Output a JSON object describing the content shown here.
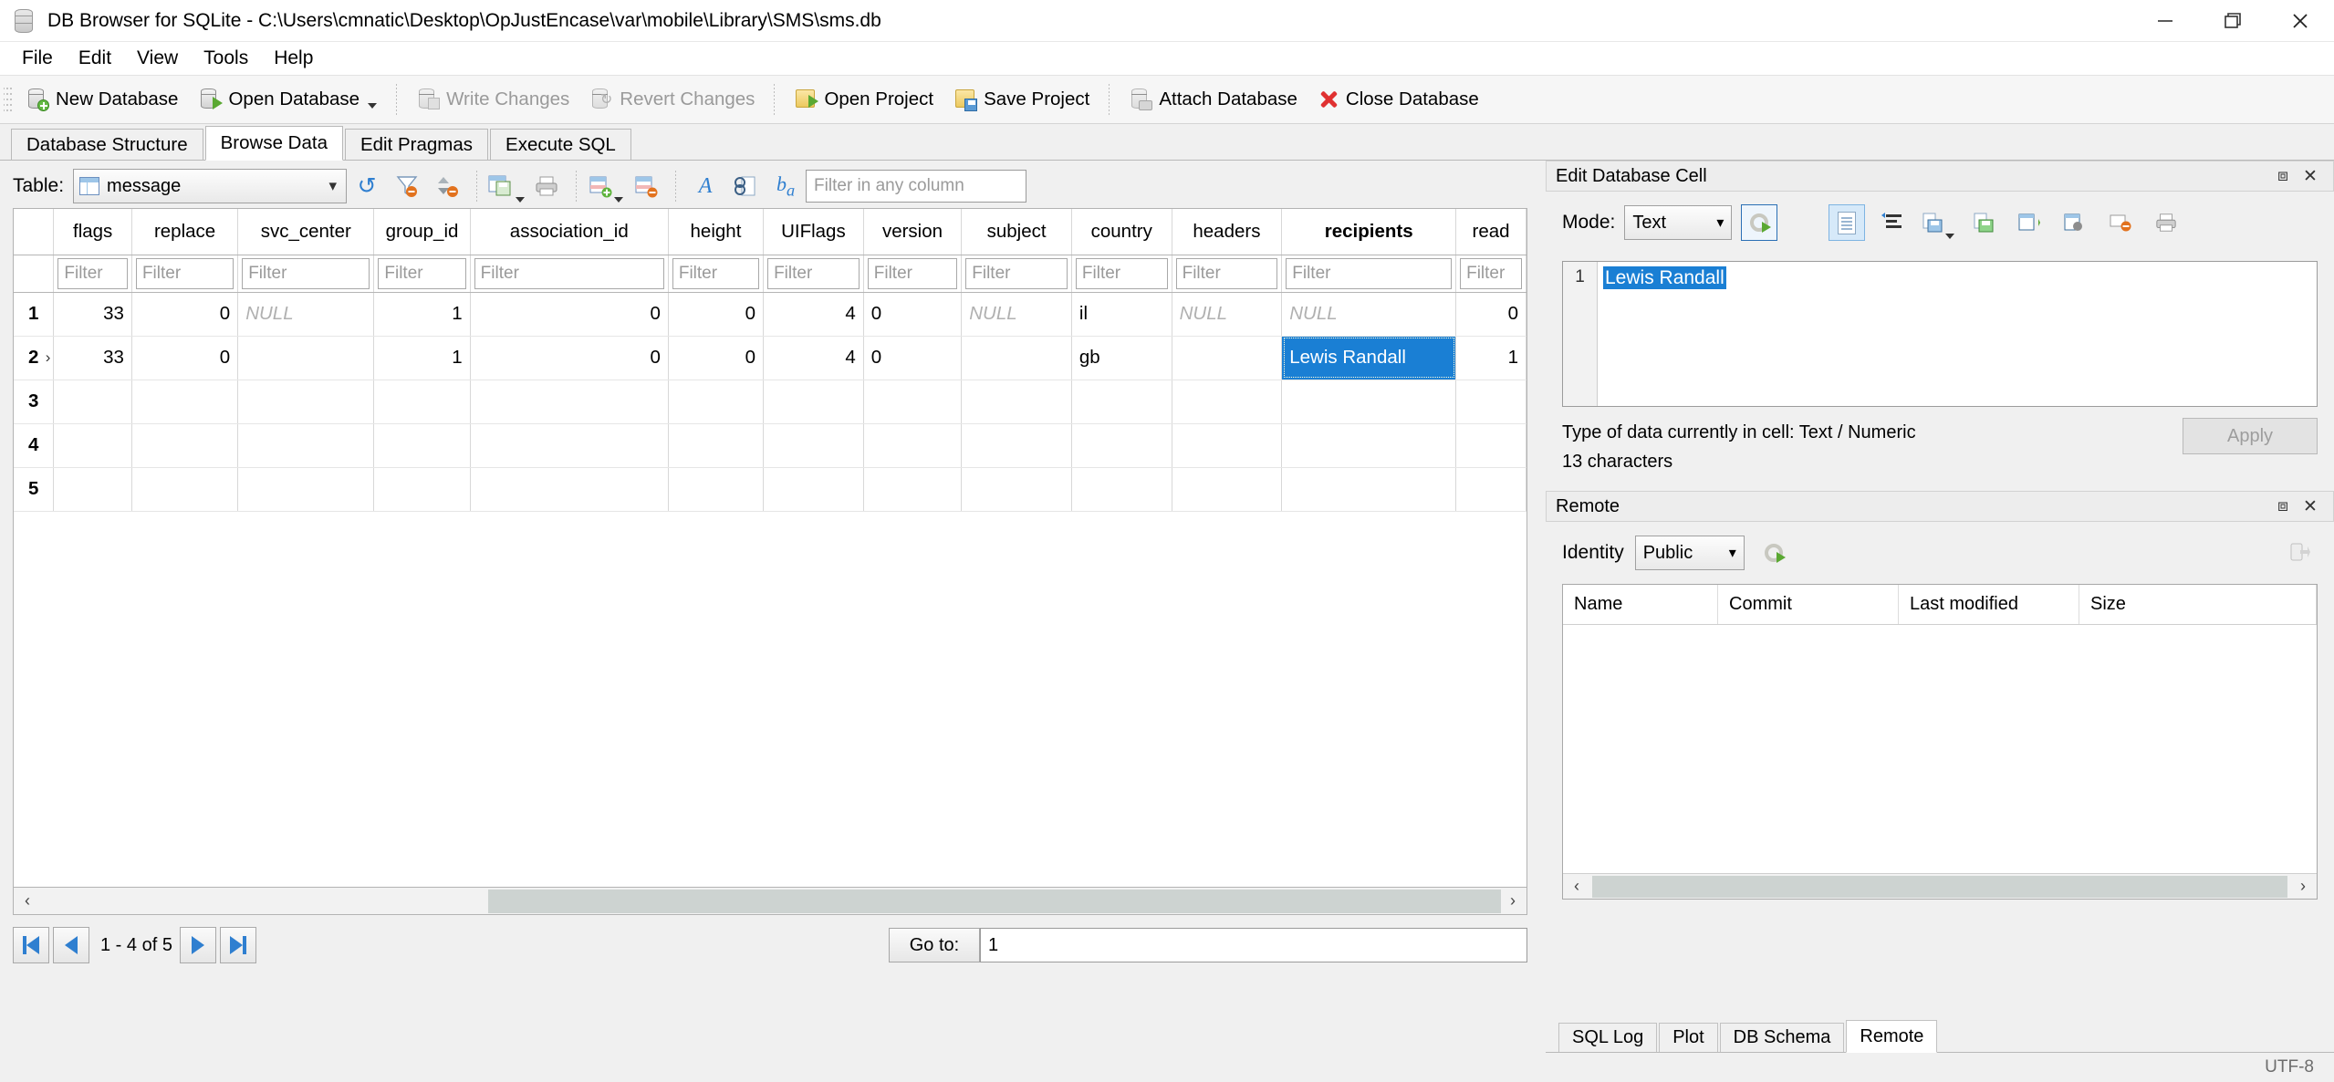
{
  "window": {
    "title": "DB Browser for SQLite - C:\\Users\\cmnatic\\Desktop\\OpJustEncase\\var\\mobile\\Library\\SMS\\sms.db",
    "minimize": "—",
    "maximize": "❐",
    "close": "✕"
  },
  "menubar": {
    "items": [
      "File",
      "Edit",
      "View",
      "Tools",
      "Help"
    ]
  },
  "toolbar": {
    "buttons": [
      {
        "label": "New Database",
        "icon": "database-new-icon",
        "enabled": true
      },
      {
        "label": "Open Database",
        "icon": "database-open-icon",
        "enabled": true
      },
      {
        "label": "Write Changes",
        "icon": "write-changes-icon",
        "enabled": false
      },
      {
        "label": "Revert Changes",
        "icon": "revert-changes-icon",
        "enabled": false
      },
      {
        "label": "Open Project",
        "icon": "project-open-icon",
        "enabled": true
      },
      {
        "label": "Save Project",
        "icon": "project-save-icon",
        "enabled": true
      },
      {
        "label": "Attach Database",
        "icon": "database-attach-icon",
        "enabled": true
      },
      {
        "label": "Close Database",
        "icon": "close-database-icon",
        "enabled": true
      }
    ]
  },
  "tabs": {
    "items": [
      "Database Structure",
      "Browse Data",
      "Edit Pragmas",
      "Execute SQL"
    ],
    "active": "Browse Data"
  },
  "browse": {
    "table_label": "Table:",
    "table_value": "message",
    "filter_placeholder": "Filter in any column",
    "toolbar_icons": [
      "refresh-icon",
      "clear-filter-icon",
      "clear-sort-icon",
      "save-results-icon",
      "print-icon",
      "insert-record-icon",
      "delete-record-icon",
      "font-size-icon",
      "find-icon",
      "conditional-format-icon"
    ]
  },
  "grid": {
    "columns": [
      "flags",
      "replace",
      "svc_center",
      "group_id",
      "association_id",
      "height",
      "UIFlags",
      "version",
      "subject",
      "country",
      "headers",
      "recipients",
      "read"
    ],
    "bold_column": "recipients",
    "filter_placeholder": "Filter",
    "rows": [
      {
        "n": "1",
        "marked": false,
        "cells": [
          {
            "v": "33",
            "align": "num"
          },
          {
            "v": "0",
            "align": "num"
          },
          {
            "v": "NULL",
            "align": "txt",
            "null": true
          },
          {
            "v": "1",
            "align": "num"
          },
          {
            "v": "0",
            "align": "num"
          },
          {
            "v": "0",
            "align": "num"
          },
          {
            "v": "4",
            "align": "num"
          },
          {
            "v": "0",
            "align": "txt"
          },
          {
            "v": "NULL",
            "align": "txt",
            "null": true
          },
          {
            "v": "il",
            "align": "txt"
          },
          {
            "v": "NULL",
            "align": "txt",
            "null": true
          },
          {
            "v": "NULL",
            "align": "txt",
            "null": true
          },
          {
            "v": "0",
            "align": "num"
          }
        ]
      },
      {
        "n": "2",
        "marked": true,
        "cells": [
          {
            "v": "33",
            "align": "num"
          },
          {
            "v": "0",
            "align": "num"
          },
          {
            "v": "",
            "align": "txt"
          },
          {
            "v": "1",
            "align": "num"
          },
          {
            "v": "0",
            "align": "num"
          },
          {
            "v": "0",
            "align": "num"
          },
          {
            "v": "4",
            "align": "num"
          },
          {
            "v": "0",
            "align": "txt"
          },
          {
            "v": "",
            "align": "txt"
          },
          {
            "v": "gb",
            "align": "txt"
          },
          {
            "v": "",
            "align": "txt"
          },
          {
            "v": "Lewis Randall",
            "align": "txt",
            "selected": true
          },
          {
            "v": "1",
            "align": "num"
          }
        ]
      },
      {
        "n": "3",
        "marked": false,
        "cells": [
          {
            "v": ""
          },
          {
            "v": ""
          },
          {
            "v": ""
          },
          {
            "v": ""
          },
          {
            "v": ""
          },
          {
            "v": ""
          },
          {
            "v": ""
          },
          {
            "v": ""
          },
          {
            "v": ""
          },
          {
            "v": ""
          },
          {
            "v": ""
          },
          {
            "v": ""
          },
          {
            "v": ""
          }
        ]
      },
      {
        "n": "4",
        "marked": false,
        "cells": [
          {
            "v": ""
          },
          {
            "v": ""
          },
          {
            "v": ""
          },
          {
            "v": ""
          },
          {
            "v": ""
          },
          {
            "v": ""
          },
          {
            "v": ""
          },
          {
            "v": ""
          },
          {
            "v": ""
          },
          {
            "v": ""
          },
          {
            "v": ""
          },
          {
            "v": ""
          },
          {
            "v": ""
          }
        ]
      },
      {
        "n": "5",
        "marked": false,
        "cells": [
          {
            "v": ""
          },
          {
            "v": ""
          },
          {
            "v": ""
          },
          {
            "v": ""
          },
          {
            "v": ""
          },
          {
            "v": ""
          },
          {
            "v": ""
          },
          {
            "v": ""
          },
          {
            "v": ""
          },
          {
            "v": ""
          },
          {
            "v": ""
          },
          {
            "v": ""
          },
          {
            "v": ""
          }
        ]
      }
    ]
  },
  "pager": {
    "range_text": "1 - 4 of 5",
    "goto_label": "Go to:",
    "goto_value": "1",
    "first_icon": "first-page-icon",
    "prev_icon": "previous-page-icon",
    "next_icon": "next-page-icon",
    "last_icon": "last-page-icon"
  },
  "edit_cell": {
    "panel_title": "Edit Database Cell",
    "float_icon": "undock-icon",
    "close_icon": "close-icon",
    "mode_label": "Mode:",
    "mode_value": "Text",
    "gutter_line": "1",
    "content": "Lewis Randall",
    "type_info": "Type of data currently in cell: Text / Numeric",
    "char_info": "13 characters",
    "apply_label": "Apply",
    "toolbar_icons": [
      "apply-settings-icon",
      "text-mode-icon",
      "word-wrap-icon",
      "import-icon",
      "export-icon",
      "open-in-app-icon",
      "open-in-external-icon",
      "set-null-icon",
      "print-icon"
    ]
  },
  "remote": {
    "panel_title": "Remote",
    "float_icon": "undock-icon",
    "close_icon": "close-icon",
    "identity_label": "Identity",
    "identity_value": "Public",
    "settings_icon": "identity-settings-icon",
    "clone_icon": "clone-database-icon",
    "columns": [
      "Name",
      "Commit",
      "Last modified",
      "Size"
    ],
    "rows": []
  },
  "bottom_tabs": {
    "items": [
      "SQL Log",
      "Plot",
      "DB Schema",
      "Remote"
    ],
    "active": "Remote"
  },
  "statusbar": {
    "encoding": "UTF-8"
  }
}
